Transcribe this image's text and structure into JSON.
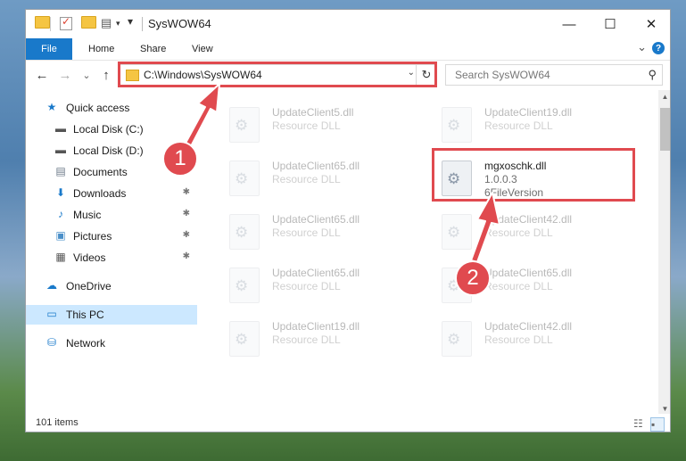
{
  "window": {
    "title": "SysWOW64",
    "controls": {
      "minimize": "—",
      "maximize": "☐",
      "close": "✕"
    }
  },
  "ribbon": {
    "tabs": [
      "File",
      "Home",
      "Share",
      "View"
    ],
    "expand_glyph": "⌄",
    "help_glyph": "?"
  },
  "navigation": {
    "back_glyph": "←",
    "forward_glyph": "→",
    "recent_glyph": "⌄",
    "up_glyph": "↑",
    "address": "C:\\Windows\\SysWOW64",
    "address_dropdown_glyph": "⌄",
    "refresh_glyph": "↻",
    "search_placeholder": "Search SysWOW64",
    "search_glyph": "⚲"
  },
  "sidebar": {
    "items": [
      {
        "label": "Quick access",
        "icon": "star-icon",
        "glyph": "★",
        "color": "#1979ca",
        "pinned": false
      },
      {
        "label": "Local Disk (C:)",
        "icon": "drive-icon",
        "glyph": "▬",
        "color": "#555555",
        "pinned": false
      },
      {
        "label": "Local Disk (D:)",
        "icon": "drive-icon",
        "glyph": "▬",
        "color": "#555555",
        "pinned": false
      },
      {
        "label": "Documents",
        "icon": "document-icon",
        "glyph": "▤",
        "color": "#6c7a89",
        "pinned": false
      },
      {
        "label": "Downloads",
        "icon": "download-icon",
        "glyph": "⬇",
        "color": "#1979ca",
        "pinned": true
      },
      {
        "label": "Music",
        "icon": "music-icon",
        "glyph": "♪",
        "color": "#1979ca",
        "pinned": true
      },
      {
        "label": "Pictures",
        "icon": "pictures-icon",
        "glyph": "▣",
        "color": "#4a8fc9",
        "pinned": true
      },
      {
        "label": "Videos",
        "icon": "video-icon",
        "glyph": "▦",
        "color": "#555555",
        "pinned": true
      },
      {
        "label": "OneDrive",
        "icon": "cloud-icon",
        "glyph": "☁",
        "color": "#1979ca",
        "pinned": false
      },
      {
        "label": "This PC",
        "icon": "computer-icon",
        "glyph": "▭",
        "color": "#1979ca",
        "pinned": false,
        "selected": true
      },
      {
        "label": "Network",
        "icon": "network-icon",
        "glyph": "⛁",
        "color": "#1979ca",
        "pinned": false
      }
    ],
    "pin_glyph": "📌"
  },
  "files": [
    {
      "name": "UpdateClient5.dll",
      "desc": "Resource DLL",
      "faded": true
    },
    {
      "name": "UpdateClient19.dll",
      "desc": "Resource DLL",
      "faded": true
    },
    {
      "name": "UpdateClient65.dll",
      "desc": "Resource DLL",
      "faded": true
    },
    {
      "name": "mgxoschk.dll",
      "desc": "1.0.0.3",
      "version": "6FileVersion",
      "faded": false,
      "highlighted": true
    },
    {
      "name": "UpdateClient65.dll",
      "desc": "Resource DLL",
      "faded": true
    },
    {
      "name": "UpdateClient42.dll",
      "desc": "Resource DLL",
      "faded": true
    },
    {
      "name": "UpdateClient65.dll",
      "desc": "Resource DLL",
      "faded": true
    },
    {
      "name": "UpdateClient65.dll",
      "desc": "Resource DLL",
      "faded": true
    },
    {
      "name": "UpdateClient19.dll",
      "desc": "Resource DLL",
      "faded": true
    },
    {
      "name": "UpdateClient42.dll",
      "desc": "Resource DLL",
      "faded": true
    }
  ],
  "status": {
    "item_count": "101 items"
  },
  "annotations": {
    "step1": "1",
    "step2": "2",
    "highlight_color": "#e04a4f"
  }
}
